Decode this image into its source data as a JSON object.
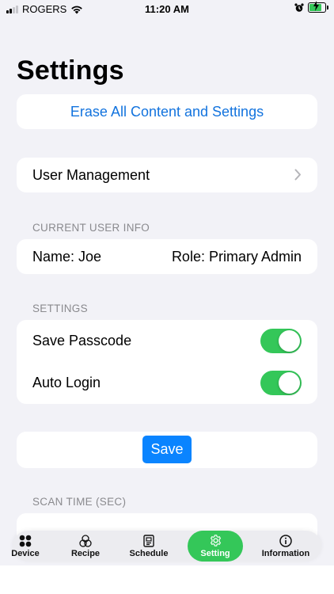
{
  "status_bar": {
    "carrier": "ROGERS",
    "time": "11:20 AM"
  },
  "page_title": "Settings",
  "erase": {
    "label": "Erase All Content and Settings"
  },
  "user_management": {
    "label": "User Management"
  },
  "current_user_info": {
    "header": "CURRENT USER INFO",
    "name": "Name: Joe",
    "role": "Role: Primary Admin"
  },
  "settings_section": {
    "header": "SETTINGS",
    "toggles": [
      {
        "label": "Save Passcode",
        "on": true
      },
      {
        "label": "Auto Login",
        "on": true
      }
    ]
  },
  "save": {
    "label": "Save"
  },
  "scan_time": {
    "header": "SCAN TIME (SEC)"
  },
  "tab_bar": {
    "active": "Setting",
    "tabs": [
      {
        "label": "Device",
        "icon": "device-grid-icon"
      },
      {
        "label": "Recipe",
        "icon": "recipe-icon"
      },
      {
        "label": "Schedule",
        "icon": "schedule-icon"
      },
      {
        "label": "Setting",
        "icon": "gear-icon"
      },
      {
        "label": "Information",
        "icon": "info-icon"
      }
    ]
  },
  "colors": {
    "background": "#f2f2f7",
    "link_blue": "#1273de",
    "button_blue": "#0a84ff",
    "toggle_green": "#34c759",
    "active_tab_green": "#34c759",
    "section_header_gray": "#8a8a8e"
  }
}
